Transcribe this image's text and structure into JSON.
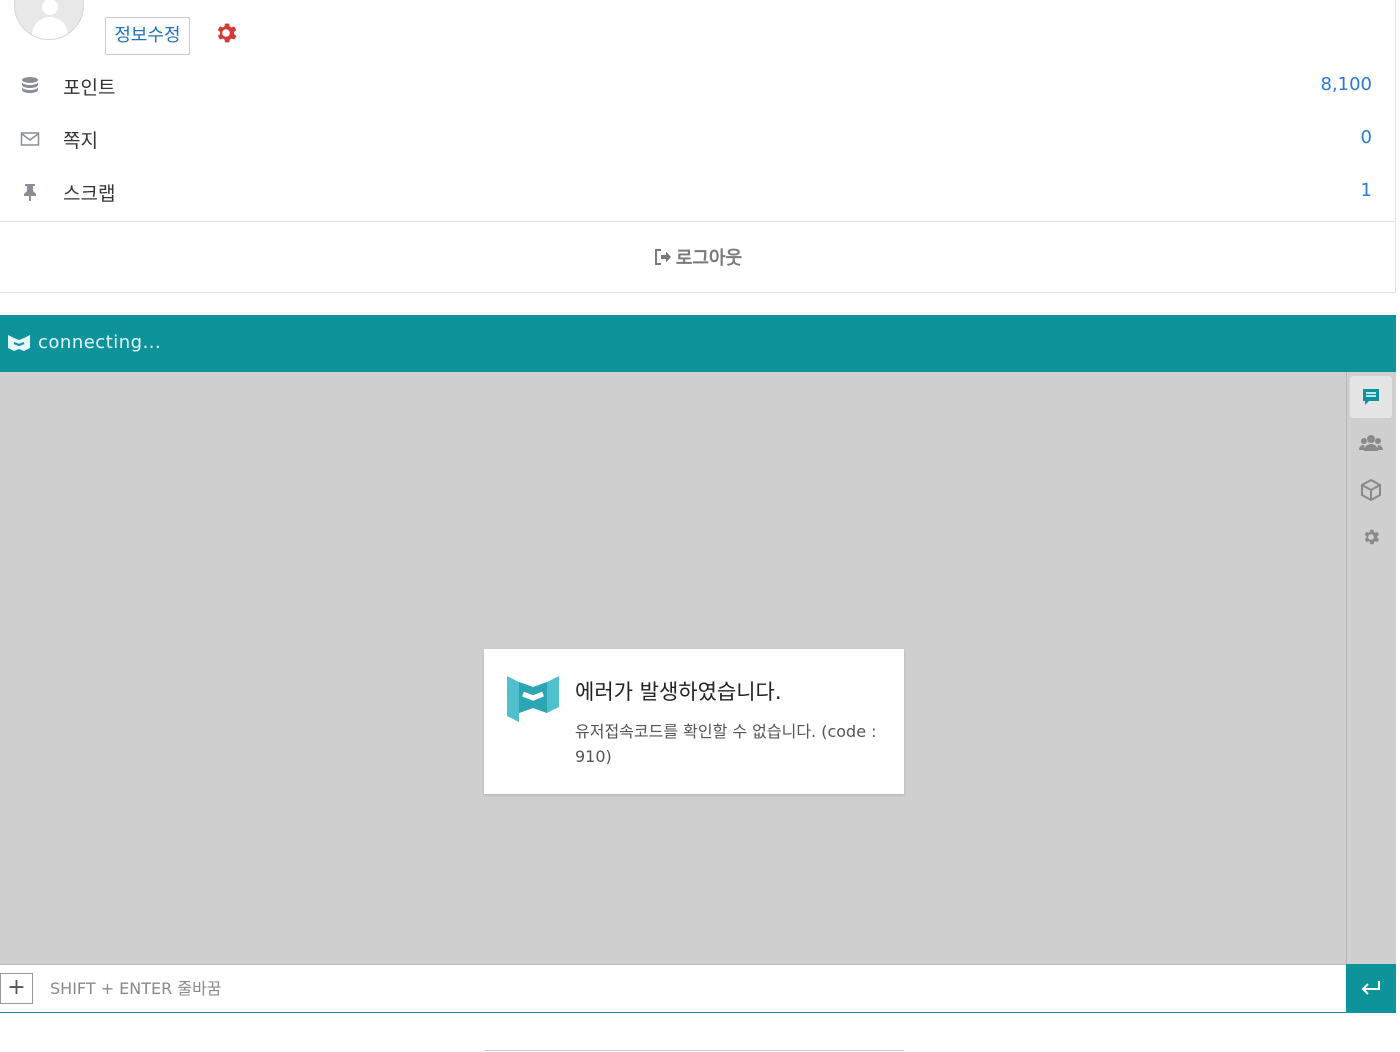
{
  "profile": {
    "edit_label": "정보수정",
    "stats": [
      {
        "icon": "database-icon",
        "label": "포인트",
        "value": "8,100"
      },
      {
        "icon": "envelope-icon",
        "label": "쪽지",
        "value": "0"
      },
      {
        "icon": "pin-icon",
        "label": "스크랩",
        "value": "1"
      }
    ],
    "logout_label": "로그아웃",
    "accent_color": "#2a7ad6",
    "gear_color": "#d43a3a"
  },
  "chat": {
    "status": "connecting...",
    "header_color": "#0e939b",
    "side_tabs": [
      {
        "icon": "chat-icon",
        "active": true
      },
      {
        "icon": "users-icon",
        "active": false
      },
      {
        "icon": "box-icon",
        "active": false
      },
      {
        "icon": "gear-icon",
        "active": false
      }
    ],
    "error": {
      "title": "에러가 발생하였습니다.",
      "message": "유저접속코드를 확인할 수 없습니다. (code : 910)"
    },
    "input": {
      "placeholder": "SHIFT + ENTER 줄바꿈",
      "add_label": "+"
    }
  }
}
